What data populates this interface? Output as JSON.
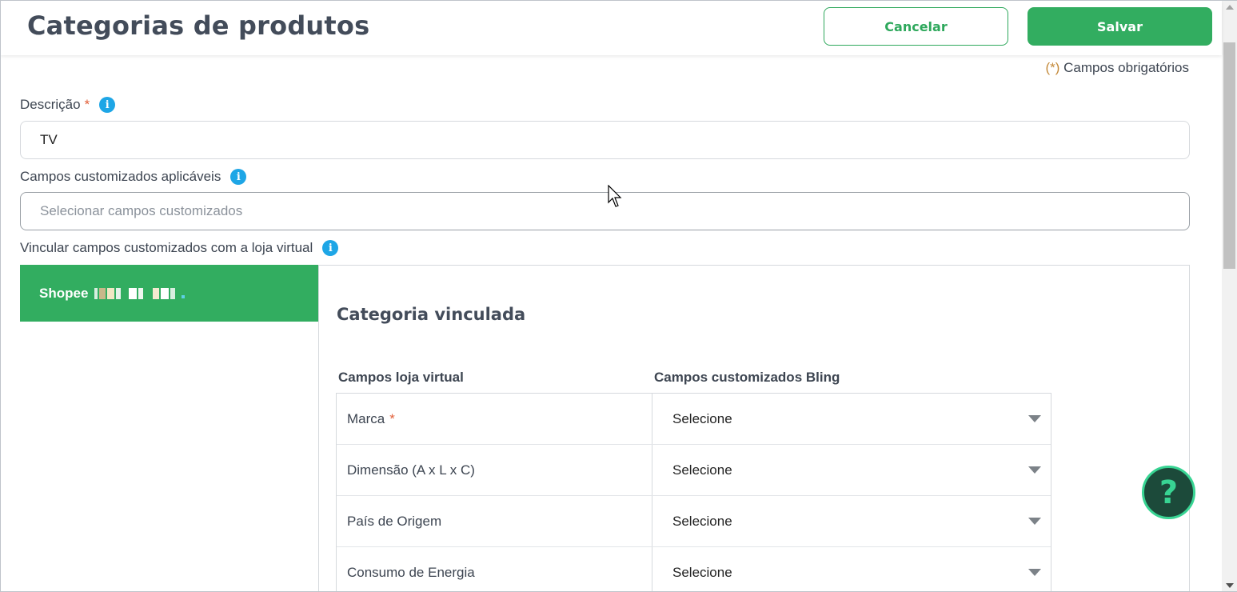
{
  "header": {
    "title": "Categorias de produtos",
    "cancel_label": "Cancelar",
    "save_label": "Salvar"
  },
  "required_note": {
    "asterisk": "(*)",
    "text": " Campos obrigatórios"
  },
  "form": {
    "description": {
      "label": "Descrição",
      "required_mark": "*",
      "value": "TV"
    },
    "custom_fields": {
      "label": "Campos customizados aplicáveis",
      "placeholder": "Selecionar campos customizados"
    },
    "link_section": {
      "label": "Vincular campos customizados com a loja virtual"
    }
  },
  "store": {
    "name": "Shopee"
  },
  "linked_category": {
    "title": "Categoria vinculada",
    "columns": [
      "Campos loja virtual",
      "Campos customizados Bling"
    ],
    "rows": [
      {
        "field": "Marca",
        "required": "*",
        "value": "Selecione"
      },
      {
        "field": "Dimensão (A x L x C)",
        "required": "",
        "value": "Selecione"
      },
      {
        "field": "País de Origem",
        "required": "",
        "value": "Selecione"
      },
      {
        "field": "Consumo de Energia",
        "required": "",
        "value": "Selecione"
      }
    ]
  },
  "help": {
    "symbol": "?"
  },
  "colors": {
    "primary_green": "#32ad60",
    "info_blue": "#1ea6e6",
    "required_orange": "#e2603a",
    "help_dark": "#1c4a3a",
    "help_accent": "#38d493"
  }
}
